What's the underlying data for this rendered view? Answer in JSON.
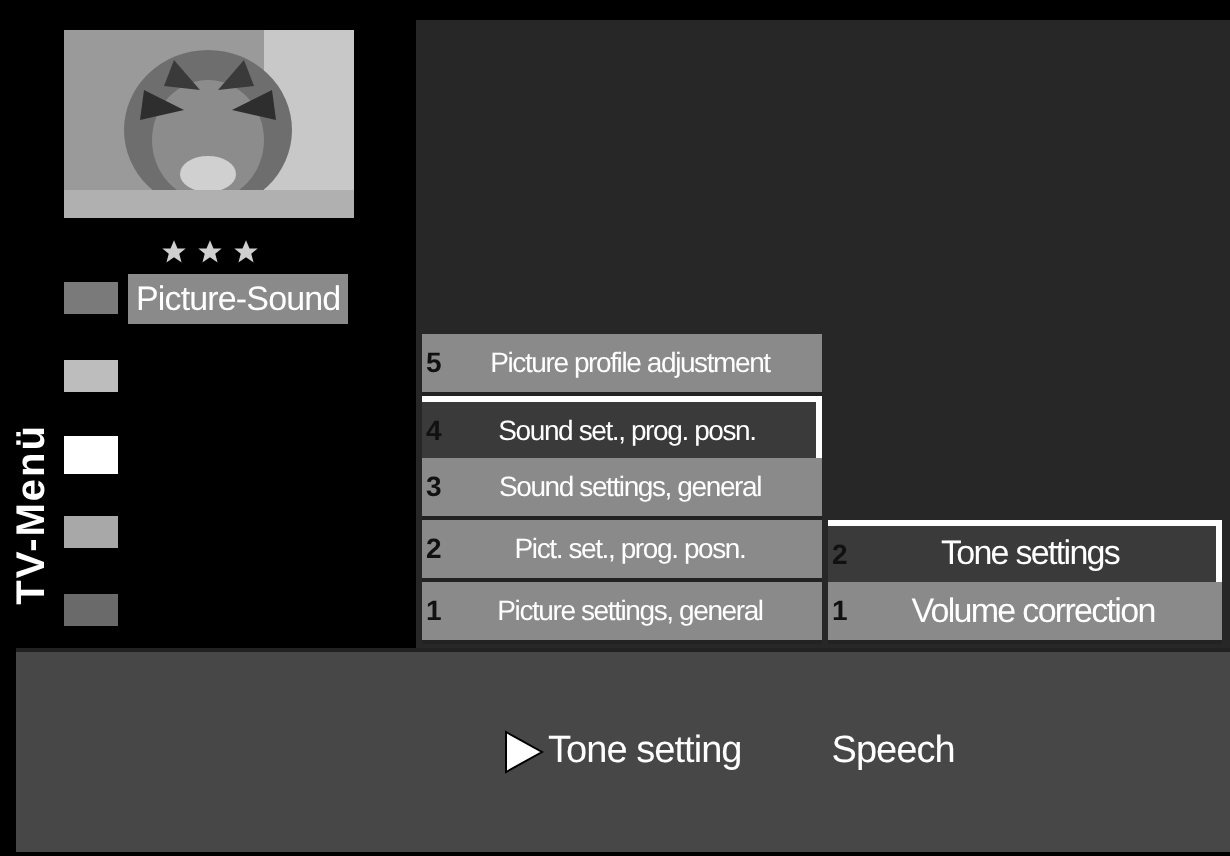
{
  "side_title": "TV-Menü",
  "preview": {
    "kind": "picture",
    "stars": 3
  },
  "categories": [
    {
      "color": "#7a7a7a",
      "selected": false
    },
    {
      "color": "#bdbdbd",
      "selected": false
    },
    {
      "color": "#ffffff",
      "selected": true
    },
    {
      "color": "#a8a8a8",
      "selected": false
    },
    {
      "color": "#6a6a6a",
      "selected": false
    }
  ],
  "category_label": "Picture-Sound",
  "menu": [
    {
      "number": "5",
      "label": "Picture profile adjustment",
      "selected": false
    },
    {
      "number": "4",
      "label": "Sound set., prog. posn.",
      "selected": true
    },
    {
      "number": "3",
      "label": "Sound settings, general",
      "selected": false
    },
    {
      "number": "2",
      "label": "Pict. set., prog. posn.",
      "selected": false
    },
    {
      "number": "1",
      "label": "Picture settings, general",
      "selected": false
    }
  ],
  "submenu": [
    {
      "number": "2",
      "label": "Tone settings",
      "selected": true
    },
    {
      "number": "1",
      "label": "Volume correction",
      "selected": false
    }
  ],
  "bottom_options": [
    {
      "label": "Tone setting",
      "selected": true
    },
    {
      "label": "Speech",
      "selected": false
    }
  ]
}
